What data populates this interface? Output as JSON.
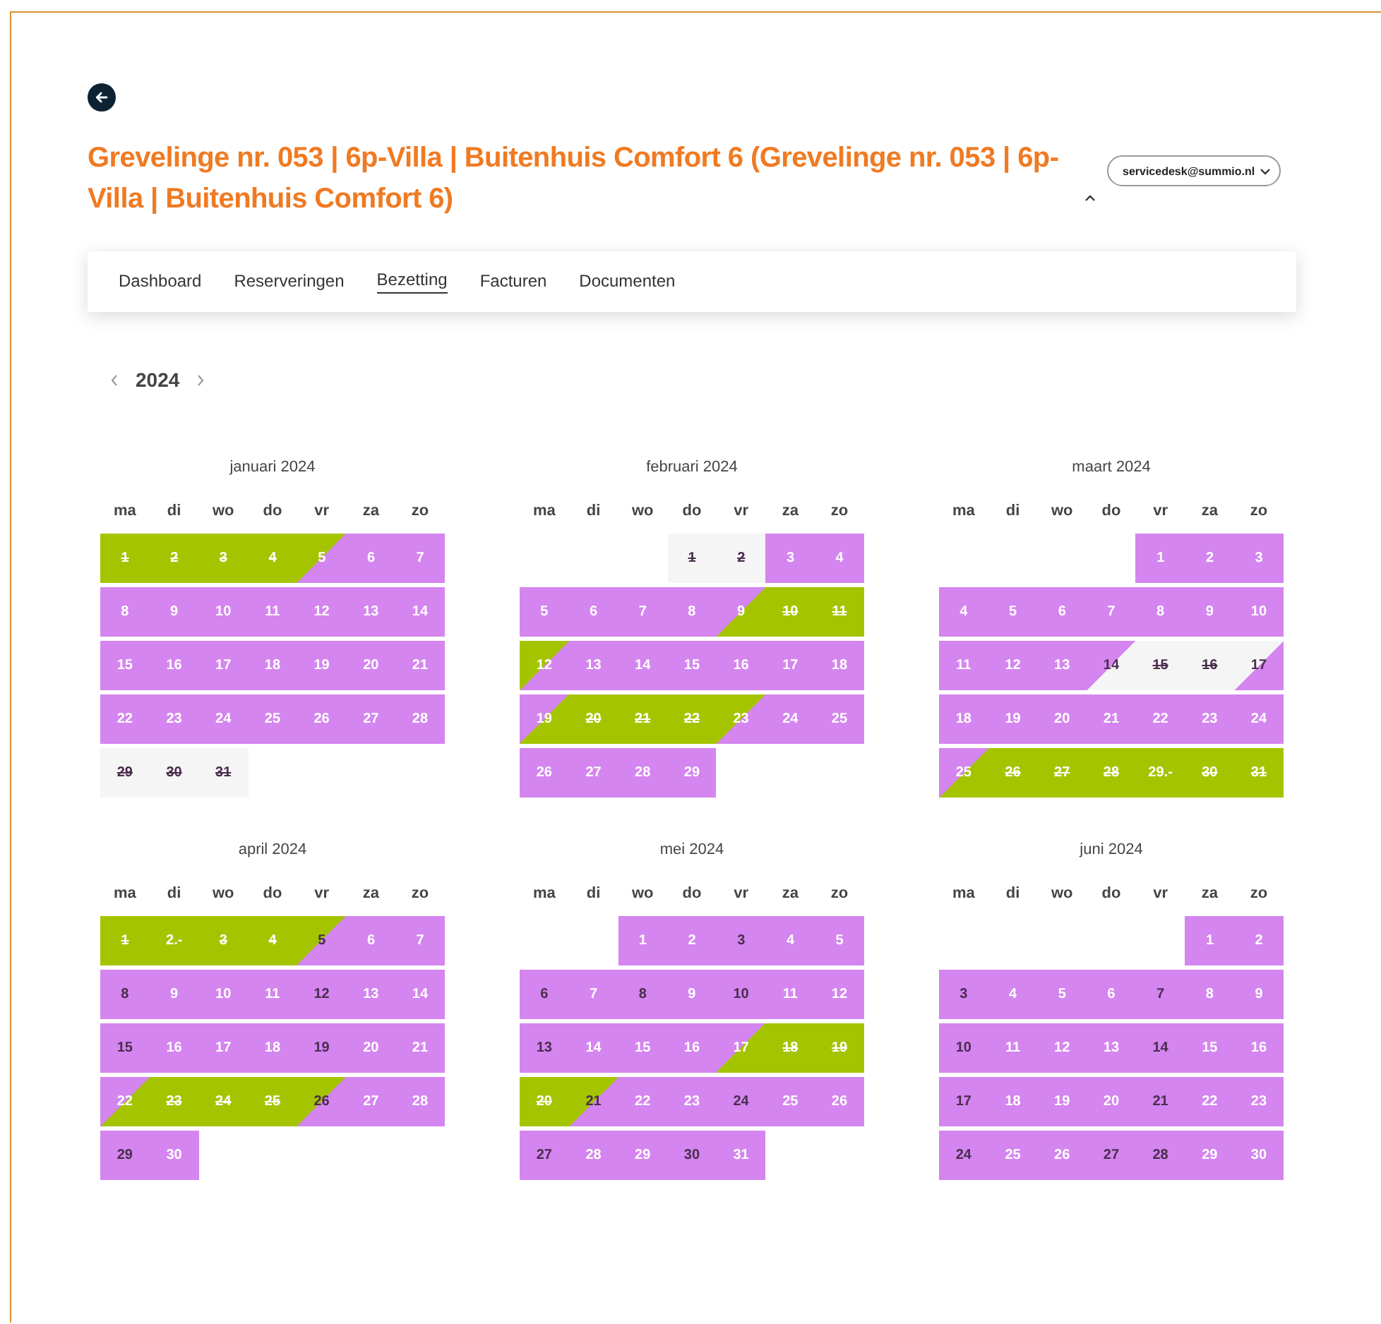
{
  "title": "Grevelinge nr. 053 | 6p-Villa | Buitenhuis Comfort 6 (Grevelinge nr. 053 | 6p-Villa | Buitenhuis Comfort 6)",
  "account": {
    "email": "servicedesk@summio.nl"
  },
  "tabs": [
    {
      "label": "Dashboard",
      "selected": false
    },
    {
      "label": "Reserveringen",
      "selected": false
    },
    {
      "label": "Bezetting",
      "selected": true
    },
    {
      "label": "Facturen",
      "selected": false
    },
    {
      "label": "Documenten",
      "selected": false
    }
  ],
  "year": "2024",
  "months": [
    {
      "name": "januari 2024",
      "weekdays": [
        "ma",
        "di",
        "wo",
        "do",
        "vr",
        "za",
        "zo"
      ],
      "weeks": [
        [
          {
            "day": "1",
            "kind": "booked",
            "struck": true,
            "dark": false
          },
          {
            "day": "2",
            "kind": "booked",
            "struck": true,
            "dark": false
          },
          {
            "day": "3",
            "kind": "booked",
            "struck": true,
            "dark": false
          },
          {
            "day": "4",
            "kind": "booked",
            "struck": true,
            "dark": false
          },
          {
            "day": "5",
            "kind": "departure",
            "struck": false,
            "dark": false
          },
          {
            "day": "6",
            "kind": "free",
            "struck": false,
            "dark": false
          },
          {
            "day": "7",
            "kind": "free",
            "struck": false,
            "dark": false
          }
        ],
        [
          {
            "day": "8",
            "kind": "free",
            "struck": false,
            "dark": false
          },
          {
            "day": "9",
            "kind": "free",
            "struck": false,
            "dark": false
          },
          {
            "day": "10",
            "kind": "free",
            "struck": false,
            "dark": false
          },
          {
            "day": "11",
            "kind": "free",
            "struck": false,
            "dark": false
          },
          {
            "day": "12",
            "kind": "free",
            "struck": false,
            "dark": false
          },
          {
            "day": "13",
            "kind": "free",
            "struck": false,
            "dark": false
          },
          {
            "day": "14",
            "kind": "free",
            "struck": false,
            "dark": false
          }
        ],
        [
          {
            "day": "15",
            "kind": "free",
            "struck": false,
            "dark": false
          },
          {
            "day": "16",
            "kind": "free",
            "struck": false,
            "dark": false
          },
          {
            "day": "17",
            "kind": "free",
            "struck": false,
            "dark": false
          },
          {
            "day": "18",
            "kind": "free",
            "struck": false,
            "dark": false
          },
          {
            "day": "19",
            "kind": "free",
            "struck": false,
            "dark": false
          },
          {
            "day": "20",
            "kind": "free",
            "struck": false,
            "dark": false
          },
          {
            "day": "21",
            "kind": "free",
            "struck": false,
            "dark": false
          }
        ],
        [
          {
            "day": "22",
            "kind": "free",
            "struck": false,
            "dark": false
          },
          {
            "day": "23",
            "kind": "free",
            "struck": false,
            "dark": false
          },
          {
            "day": "24",
            "kind": "free",
            "struck": false,
            "dark": false
          },
          {
            "day": "25",
            "kind": "free",
            "struck": false,
            "dark": false
          },
          {
            "day": "26",
            "kind": "free",
            "struck": false,
            "dark": false
          },
          {
            "day": "27",
            "kind": "free",
            "struck": false,
            "dark": false
          },
          {
            "day": "28",
            "kind": "free",
            "struck": false,
            "dark": false
          }
        ],
        [
          {
            "day": "29",
            "kind": "closed",
            "struck": true,
            "dark": true
          },
          {
            "day": "30",
            "kind": "closed",
            "struck": true,
            "dark": true
          },
          {
            "day": "31",
            "kind": "closed",
            "struck": true,
            "dark": true
          }
        ]
      ]
    },
    {
      "name": "februari 2024",
      "weekdays": [
        "ma",
        "di",
        "wo",
        "do",
        "vr",
        "za",
        "zo"
      ],
      "weeks": [
        [
          {
            "day": "1",
            "kind": "closed",
            "struck": true,
            "dark": true
          },
          {
            "day": "2",
            "kind": "closed",
            "struck": true,
            "dark": true
          },
          {
            "day": "3",
            "kind": "free",
            "struck": false,
            "dark": false
          },
          {
            "day": "4",
            "kind": "free",
            "struck": false,
            "dark": false
          }
        ],
        [
          {
            "day": "5",
            "kind": "free",
            "struck": false,
            "dark": false
          },
          {
            "day": "6",
            "kind": "free",
            "struck": false,
            "dark": false
          },
          {
            "day": "7",
            "kind": "free",
            "struck": false,
            "dark": false
          },
          {
            "day": "8",
            "kind": "free",
            "struck": false,
            "dark": false
          },
          {
            "day": "9",
            "kind": "arrival",
            "struck": false,
            "dark": false
          },
          {
            "day": "10",
            "kind": "booked",
            "struck": true,
            "dark": false
          },
          {
            "day": "11",
            "kind": "booked",
            "struck": true,
            "dark": false
          }
        ],
        [
          {
            "day": "12",
            "kind": "departure",
            "struck": false,
            "dark": false
          },
          {
            "day": "13",
            "kind": "free",
            "struck": false,
            "dark": false
          },
          {
            "day": "14",
            "kind": "free",
            "struck": false,
            "dark": false
          },
          {
            "day": "15",
            "kind": "free",
            "struck": false,
            "dark": false
          },
          {
            "day": "16",
            "kind": "free",
            "struck": false,
            "dark": false
          },
          {
            "day": "17",
            "kind": "free",
            "struck": false,
            "dark": false
          },
          {
            "day": "18",
            "kind": "free",
            "struck": false,
            "dark": false
          }
        ],
        [
          {
            "day": "19",
            "kind": "arrival",
            "struck": false,
            "dark": false
          },
          {
            "day": "20",
            "kind": "booked",
            "struck": true,
            "dark": false
          },
          {
            "day": "21",
            "kind": "booked",
            "struck": true,
            "dark": false
          },
          {
            "day": "22",
            "kind": "booked",
            "struck": true,
            "dark": false
          },
          {
            "day": "23",
            "kind": "departure",
            "struck": false,
            "dark": false
          },
          {
            "day": "24",
            "kind": "free",
            "struck": false,
            "dark": false
          },
          {
            "day": "25",
            "kind": "free",
            "struck": false,
            "dark": false
          }
        ],
        [
          {
            "day": "26",
            "kind": "free",
            "struck": false,
            "dark": false
          },
          {
            "day": "27",
            "kind": "free",
            "struck": false,
            "dark": false
          },
          {
            "day": "28",
            "kind": "free",
            "struck": false,
            "dark": false
          },
          {
            "day": "29",
            "kind": "free",
            "struck": false,
            "dark": false
          }
        ]
      ]
    },
    {
      "name": "maart 2024",
      "weekdays": [
        "ma",
        "di",
        "wo",
        "do",
        "vr",
        "za",
        "zo"
      ],
      "weeks": [
        [
          {
            "day": "1",
            "kind": "free",
            "struck": false,
            "dark": false
          },
          {
            "day": "2",
            "kind": "free",
            "struck": false,
            "dark": false
          },
          {
            "day": "3",
            "kind": "free",
            "struck": false,
            "dark": false
          }
        ],
        [
          {
            "day": "4",
            "kind": "free",
            "struck": false,
            "dark": false
          },
          {
            "day": "5",
            "kind": "free",
            "struck": false,
            "dark": false
          },
          {
            "day": "6",
            "kind": "free",
            "struck": false,
            "dark": false
          },
          {
            "day": "7",
            "kind": "free",
            "struck": false,
            "dark": false
          },
          {
            "day": "8",
            "kind": "free",
            "struck": false,
            "dark": false
          },
          {
            "day": "9",
            "kind": "free",
            "struck": false,
            "dark": false
          },
          {
            "day": "10",
            "kind": "free",
            "struck": false,
            "dark": false
          }
        ],
        [
          {
            "day": "11",
            "kind": "free",
            "struck": false,
            "dark": false
          },
          {
            "day": "12",
            "kind": "free",
            "struck": false,
            "dark": false
          },
          {
            "day": "13",
            "kind": "free",
            "struck": false,
            "dark": false
          },
          {
            "day": "14",
            "kind": "closing",
            "struck": false,
            "dark": true
          },
          {
            "day": "15",
            "kind": "closed",
            "struck": true,
            "dark": true
          },
          {
            "day": "16",
            "kind": "closed",
            "struck": true,
            "dark": true
          },
          {
            "day": "17",
            "kind": "opening",
            "struck": false,
            "dark": true
          }
        ],
        [
          {
            "day": "18",
            "kind": "free",
            "struck": false,
            "dark": false
          },
          {
            "day": "19",
            "kind": "free",
            "struck": false,
            "dark": false
          },
          {
            "day": "20",
            "kind": "free",
            "struck": false,
            "dark": false
          },
          {
            "day": "21",
            "kind": "free",
            "struck": false,
            "dark": false
          },
          {
            "day": "22",
            "kind": "free",
            "struck": false,
            "dark": false
          },
          {
            "day": "23",
            "kind": "free",
            "struck": false,
            "dark": false
          },
          {
            "day": "24",
            "kind": "free",
            "struck": false,
            "dark": false
          }
        ],
        [
          {
            "day": "25",
            "kind": "arrival",
            "struck": false,
            "dark": false
          },
          {
            "day": "26",
            "kind": "booked",
            "struck": true,
            "dark": false
          },
          {
            "day": "27",
            "kind": "booked",
            "struck": true,
            "dark": false
          },
          {
            "day": "28",
            "kind": "booked",
            "struck": true,
            "dark": false
          },
          {
            "day": "29.-",
            "kind": "booked",
            "struck": false,
            "dark": false
          },
          {
            "day": "30",
            "kind": "booked",
            "struck": true,
            "dark": false
          },
          {
            "day": "31",
            "kind": "booked",
            "struck": true,
            "dark": false
          }
        ]
      ]
    },
    {
      "name": "april 2024",
      "weekdays": [
        "ma",
        "di",
        "wo",
        "do",
        "vr",
        "za",
        "zo"
      ],
      "weeks": [
        [
          {
            "day": "1",
            "kind": "booked",
            "struck": true,
            "dark": false
          },
          {
            "day": "2.-",
            "kind": "booked",
            "struck": false,
            "dark": false
          },
          {
            "day": "3",
            "kind": "booked",
            "struck": true,
            "dark": false
          },
          {
            "day": "4",
            "kind": "booked",
            "struck": true,
            "dark": false
          },
          {
            "day": "5",
            "kind": "departure",
            "struck": false,
            "dark": true
          },
          {
            "day": "6",
            "kind": "free",
            "struck": false,
            "dark": false
          },
          {
            "day": "7",
            "kind": "free",
            "struck": false,
            "dark": false
          }
        ],
        [
          {
            "day": "8",
            "kind": "free",
            "struck": false,
            "dark": true
          },
          {
            "day": "9",
            "kind": "free",
            "struck": false,
            "dark": false
          },
          {
            "day": "10",
            "kind": "free",
            "struck": false,
            "dark": false
          },
          {
            "day": "11",
            "kind": "free",
            "struck": false,
            "dark": false
          },
          {
            "day": "12",
            "kind": "free",
            "struck": false,
            "dark": true
          },
          {
            "day": "13",
            "kind": "free",
            "struck": false,
            "dark": false
          },
          {
            "day": "14",
            "kind": "free",
            "struck": false,
            "dark": false
          }
        ],
        [
          {
            "day": "15",
            "kind": "free",
            "struck": false,
            "dark": true
          },
          {
            "day": "16",
            "kind": "free",
            "struck": false,
            "dark": false
          },
          {
            "day": "17",
            "kind": "free",
            "struck": false,
            "dark": false
          },
          {
            "day": "18",
            "kind": "free",
            "struck": false,
            "dark": false
          },
          {
            "day": "19",
            "kind": "free",
            "struck": false,
            "dark": true
          },
          {
            "day": "20",
            "kind": "free",
            "struck": false,
            "dark": false
          },
          {
            "day": "21",
            "kind": "free",
            "struck": false,
            "dark": false
          }
        ],
        [
          {
            "day": "22",
            "kind": "arrival",
            "struck": false,
            "dark": false
          },
          {
            "day": "23",
            "kind": "booked",
            "struck": true,
            "dark": false
          },
          {
            "day": "24",
            "kind": "booked",
            "struck": true,
            "dark": false
          },
          {
            "day": "25",
            "kind": "booked",
            "struck": true,
            "dark": false
          },
          {
            "day": "26",
            "kind": "departure",
            "struck": false,
            "dark": true
          },
          {
            "day": "27",
            "kind": "free",
            "struck": false,
            "dark": false
          },
          {
            "day": "28",
            "kind": "free",
            "struck": false,
            "dark": false
          }
        ],
        [
          {
            "day": "29",
            "kind": "free",
            "struck": false,
            "dark": true
          },
          {
            "day": "30",
            "kind": "free",
            "struck": false,
            "dark": false
          }
        ]
      ]
    },
    {
      "name": "mei 2024",
      "weekdays": [
        "ma",
        "di",
        "wo",
        "do",
        "vr",
        "za",
        "zo"
      ],
      "weeks": [
        [
          {
            "day": "1",
            "kind": "free",
            "struck": false,
            "dark": false
          },
          {
            "day": "2",
            "kind": "free",
            "struck": false,
            "dark": false
          },
          {
            "day": "3",
            "kind": "free",
            "struck": false,
            "dark": true
          },
          {
            "day": "4",
            "kind": "free",
            "struck": false,
            "dark": false
          },
          {
            "day": "5",
            "kind": "free",
            "struck": false,
            "dark": false
          }
        ],
        [
          {
            "day": "6",
            "kind": "free",
            "struck": false,
            "dark": true
          },
          {
            "day": "7",
            "kind": "free",
            "struck": false,
            "dark": false
          },
          {
            "day": "8",
            "kind": "free",
            "struck": false,
            "dark": true
          },
          {
            "day": "9",
            "kind": "free",
            "struck": false,
            "dark": false
          },
          {
            "day": "10",
            "kind": "free",
            "struck": false,
            "dark": true
          },
          {
            "day": "11",
            "kind": "free",
            "struck": false,
            "dark": false
          },
          {
            "day": "12",
            "kind": "free",
            "struck": false,
            "dark": false
          }
        ],
        [
          {
            "day": "13",
            "kind": "free",
            "struck": false,
            "dark": true
          },
          {
            "day": "14",
            "kind": "free",
            "struck": false,
            "dark": false
          },
          {
            "day": "15",
            "kind": "free",
            "struck": false,
            "dark": false
          },
          {
            "day": "16",
            "kind": "free",
            "struck": false,
            "dark": false
          },
          {
            "day": "17",
            "kind": "arrival",
            "struck": false,
            "dark": false
          },
          {
            "day": "18",
            "kind": "booked",
            "struck": true,
            "dark": false
          },
          {
            "day": "19",
            "kind": "booked",
            "struck": true,
            "dark": false
          }
        ],
        [
          {
            "day": "20",
            "kind": "booked",
            "struck": true,
            "dark": false
          },
          {
            "day": "21",
            "kind": "departure",
            "struck": false,
            "dark": true
          },
          {
            "day": "22",
            "kind": "free",
            "struck": false,
            "dark": false
          },
          {
            "day": "23",
            "kind": "free",
            "struck": false,
            "dark": false
          },
          {
            "day": "24",
            "kind": "free",
            "struck": false,
            "dark": true
          },
          {
            "day": "25",
            "kind": "free",
            "struck": false,
            "dark": false
          },
          {
            "day": "26",
            "kind": "free",
            "struck": false,
            "dark": false
          }
        ],
        [
          {
            "day": "27",
            "kind": "free",
            "struck": false,
            "dark": true
          },
          {
            "day": "28",
            "kind": "free",
            "struck": false,
            "dark": false
          },
          {
            "day": "29",
            "kind": "free",
            "struck": false,
            "dark": false
          },
          {
            "day": "30",
            "kind": "free",
            "struck": false,
            "dark": true
          },
          {
            "day": "31",
            "kind": "free",
            "struck": false,
            "dark": false
          }
        ]
      ]
    },
    {
      "name": "juni 2024",
      "weekdays": [
        "ma",
        "di",
        "wo",
        "do",
        "vr",
        "za",
        "zo"
      ],
      "weeks": [
        [
          {
            "day": "1",
            "kind": "free",
            "struck": false,
            "dark": false
          },
          {
            "day": "2",
            "kind": "free",
            "struck": false,
            "dark": false
          }
        ],
        [
          {
            "day": "3",
            "kind": "free",
            "struck": false,
            "dark": true
          },
          {
            "day": "4",
            "kind": "free",
            "struck": false,
            "dark": false
          },
          {
            "day": "5",
            "kind": "free",
            "struck": false,
            "dark": false
          },
          {
            "day": "6",
            "kind": "free",
            "struck": false,
            "dark": false
          },
          {
            "day": "7",
            "kind": "free",
            "struck": false,
            "dark": true
          },
          {
            "day": "8",
            "kind": "free",
            "struck": false,
            "dark": false
          },
          {
            "day": "9",
            "kind": "free",
            "struck": false,
            "dark": false
          }
        ],
        [
          {
            "day": "10",
            "kind": "free",
            "struck": false,
            "dark": true
          },
          {
            "day": "11",
            "kind": "free",
            "struck": false,
            "dark": false
          },
          {
            "day": "12",
            "kind": "free",
            "struck": false,
            "dark": false
          },
          {
            "day": "13",
            "kind": "free",
            "struck": false,
            "dark": false
          },
          {
            "day": "14",
            "kind": "free",
            "struck": false,
            "dark": true
          },
          {
            "day": "15",
            "kind": "free",
            "struck": false,
            "dark": false
          },
          {
            "day": "16",
            "kind": "free",
            "struck": false,
            "dark": false
          }
        ],
        [
          {
            "day": "17",
            "kind": "free",
            "struck": false,
            "dark": true
          },
          {
            "day": "18",
            "kind": "free",
            "struck": false,
            "dark": false
          },
          {
            "day": "19",
            "kind": "free",
            "struck": false,
            "dark": false
          },
          {
            "day": "20",
            "kind": "free",
            "struck": false,
            "dark": false
          },
          {
            "day": "21",
            "kind": "free",
            "struck": false,
            "dark": true
          },
          {
            "day": "22",
            "kind": "free",
            "struck": false,
            "dark": false
          },
          {
            "day": "23",
            "kind": "free",
            "struck": false,
            "dark": false
          }
        ],
        [
          {
            "day": "24",
            "kind": "free",
            "struck": false,
            "dark": true
          },
          {
            "day": "25",
            "kind": "free",
            "struck": false,
            "dark": false
          },
          {
            "day": "26",
            "kind": "free",
            "struck": false,
            "dark": false
          },
          {
            "day": "27",
            "kind": "free",
            "struck": false,
            "dark": true
          },
          {
            "day": "28",
            "kind": "free",
            "struck": false,
            "dark": true
          },
          {
            "day": "29",
            "kind": "free",
            "struck": false,
            "dark": false
          },
          {
            "day": "30",
            "kind": "free",
            "struck": false,
            "dark": false
          }
        ]
      ]
    }
  ]
}
